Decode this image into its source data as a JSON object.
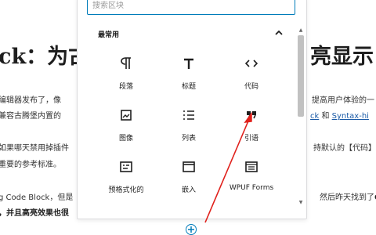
{
  "article": {
    "title_left": "ck：为古",
    "title_right": "亮显示",
    "line1_left": "编辑器发布了，像",
    "line1_right": "提高用户体验的一",
    "line2_left": "兼容古腾堡内置的",
    "line2_link1": "ck",
    "line2_and": " 和 ",
    "line2_link2": "Syntax-hi",
    "line3_left": "如果哪天禁用掉插件",
    "line3_right": "持默认的【代码】",
    "line4_left": "重要的参考标准。",
    "line5_left": "g Code Block，但是",
    "line5_right": "然后昨天找到了",
    "line5_right_bold": "C",
    "line6_left": "，并且高亮效果也很"
  },
  "inserter": {
    "search_placeholder": "搜索区块",
    "category_title": "最常用",
    "blocks": [
      {
        "label": "段落",
        "icon": "paragraph-icon"
      },
      {
        "label": "标题",
        "icon": "heading-icon"
      },
      {
        "label": "代码",
        "icon": "code-icon"
      },
      {
        "label": "图像",
        "icon": "image-icon"
      },
      {
        "label": "列表",
        "icon": "list-icon"
      },
      {
        "label": "引语",
        "icon": "quote-icon"
      },
      {
        "label": "预格式化的",
        "icon": "preformatted-icon"
      },
      {
        "label": "嵌入",
        "icon": "embed-icon"
      },
      {
        "label": "WPUF Forms",
        "icon": "wpuf-forms-icon"
      }
    ]
  },
  "colors": {
    "accent": "#007cba",
    "arrow": "#e0201b",
    "link": "#1a5aa6"
  }
}
